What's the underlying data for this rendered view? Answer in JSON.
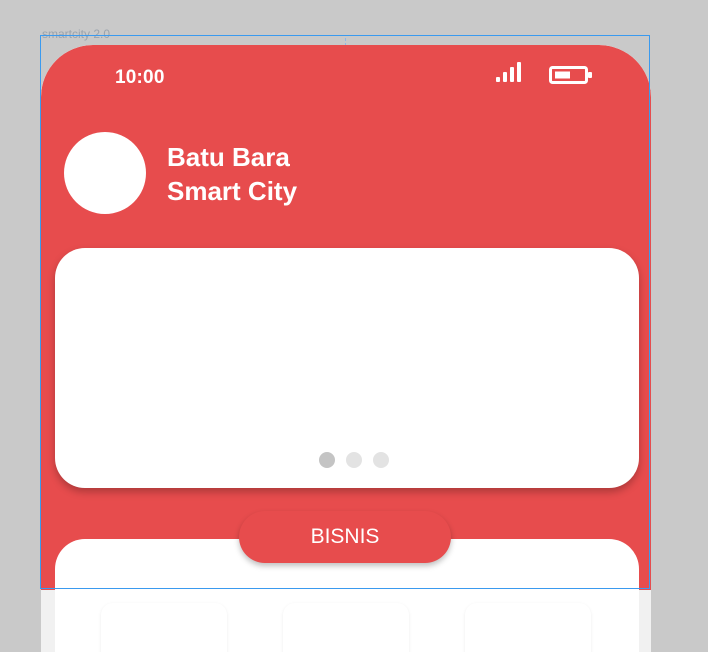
{
  "artboard": {
    "name": "smartcity 2.0"
  },
  "status_bar": {
    "time": "10:00",
    "signal_icon": "signal-icon",
    "battery_icon": "battery-icon"
  },
  "header": {
    "title_line1": "Batu Bara",
    "title_line2": "Smart City",
    "avatar_icon": "avatar"
  },
  "banner": {
    "slides": 3,
    "active_index": 0
  },
  "section": {
    "label": "BISNIS"
  },
  "colors": {
    "primary": "#e74c4d",
    "background": "#c9c9c9",
    "card": "#ffffff",
    "selection": "#3a9aef"
  }
}
